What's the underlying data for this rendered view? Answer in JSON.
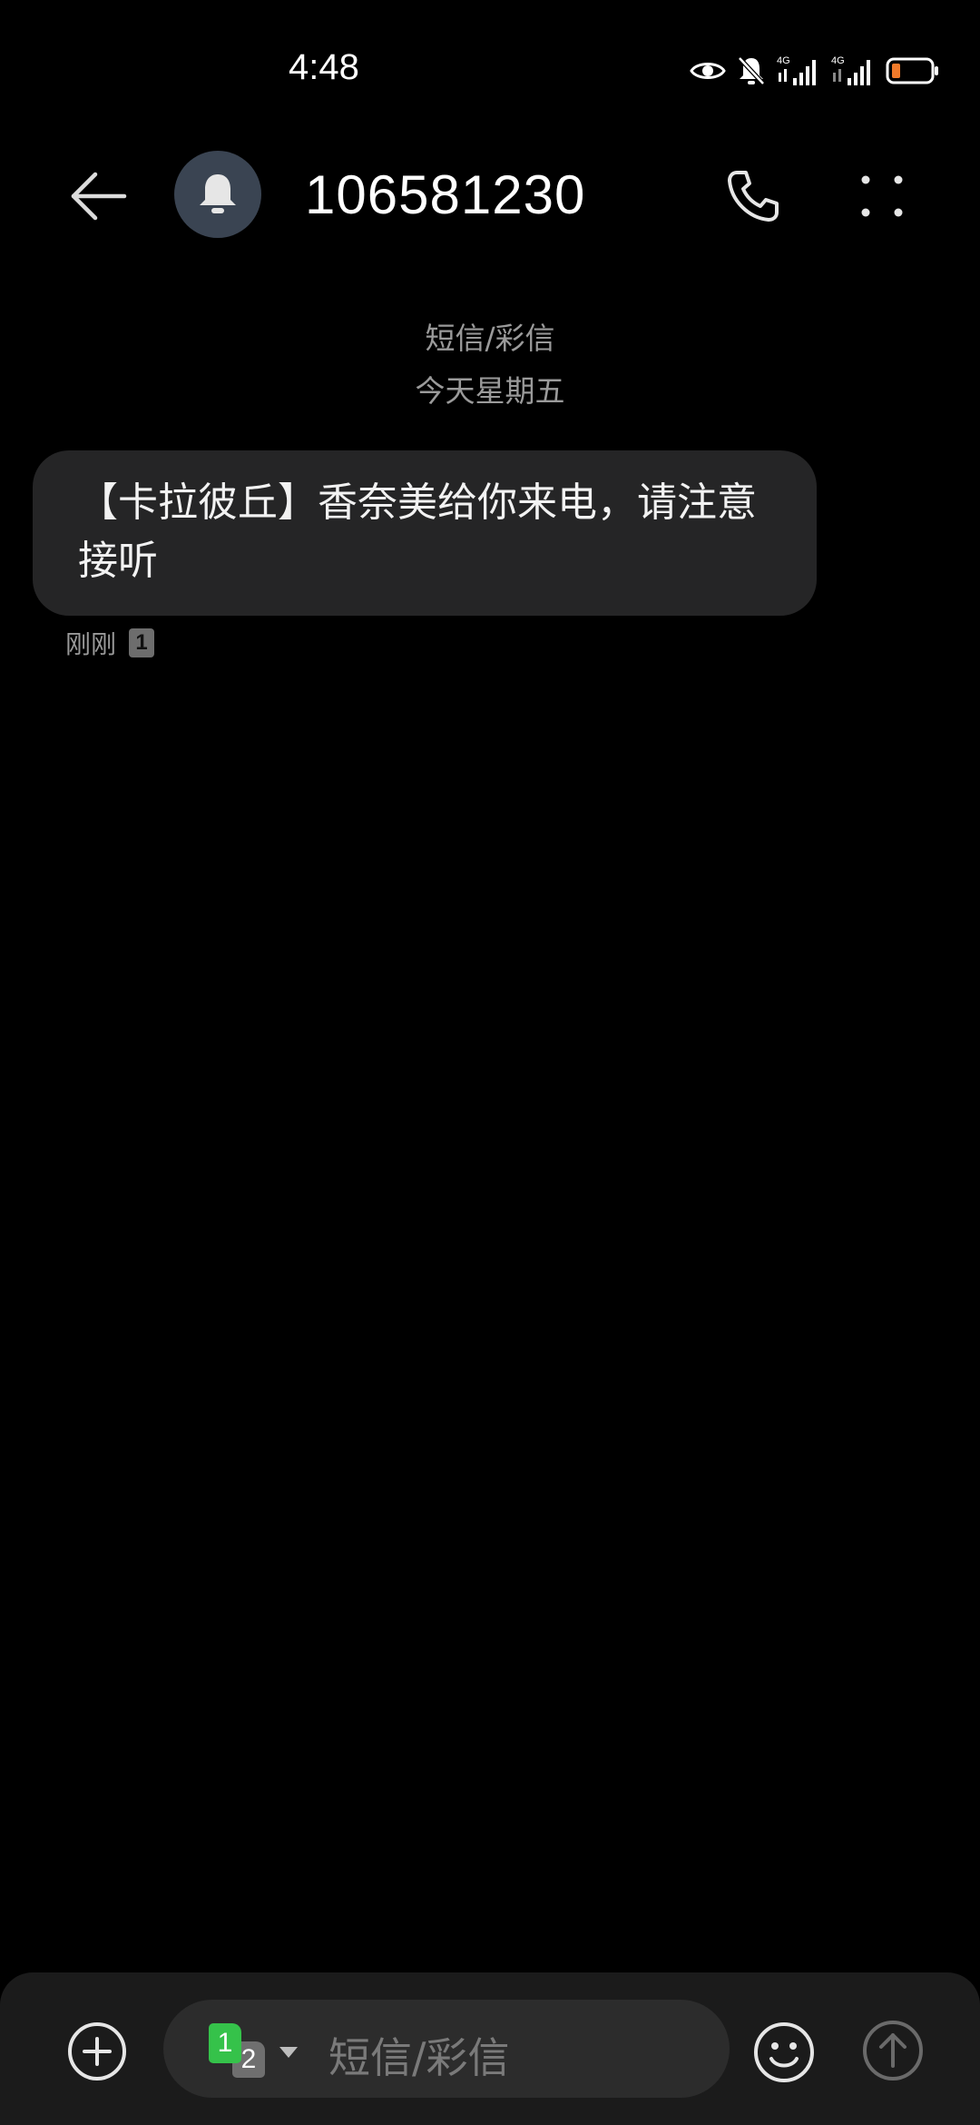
{
  "status_bar": {
    "time": "4:48",
    "signal1_label": "4G",
    "signal2_label": "4G"
  },
  "header": {
    "title": "106581230",
    "avatar_icon": "bell-icon",
    "back_icon": "arrow-left-icon",
    "call_icon": "phone-icon",
    "more_icon": "more-dots-icon"
  },
  "thread": {
    "type_label": "短信/彩信",
    "date_label": "今天星期五"
  },
  "messages": [
    {
      "text": "【卡拉彼丘】香奈美给你来电，请注意接听",
      "time": "刚刚",
      "sim": "1"
    }
  ],
  "composer": {
    "placeholder": "短信/彩信",
    "sim_primary": "1",
    "sim_secondary": "2",
    "add_icon": "plus-circle-icon",
    "emoji_icon": "smiley-icon",
    "send_icon": "arrow-up-circle-icon"
  },
  "colors": {
    "background": "#000000",
    "bubble": "#252526",
    "composer": "#1b1b1b",
    "sim_active": "#35c24a",
    "battery_low": "#f07a2a"
  }
}
